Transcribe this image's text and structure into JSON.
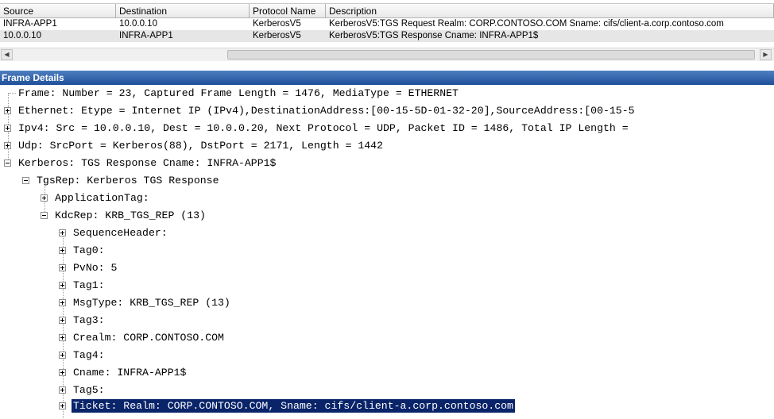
{
  "grid": {
    "columns": [
      "Source",
      "Destination",
      "Protocol Name",
      "Description"
    ],
    "rows": [
      {
        "source": "INFRA-APP1",
        "destination": "10.0.0.10",
        "protocol": "KerberosV5",
        "description": "KerberosV5:TGS Request Realm: CORP.CONTOSO.COM Sname: cifs/client-a.corp.contoso.com"
      },
      {
        "source": "10.0.0.10",
        "destination": "INFRA-APP1",
        "protocol": "KerberosV5",
        "description": "KerberosV5:TGS Response Cname: INFRA-APP1$"
      }
    ]
  },
  "details": {
    "title": "Frame Details",
    "nodes": [
      {
        "text": "Frame: Number = 23, Captured Frame Length = 1476, MediaType = ETHERNET",
        "expander": "none",
        "selected": false
      },
      {
        "text": "Ethernet: Etype = Internet IP (IPv4),DestinationAddress:[00-15-5D-01-32-20],SourceAddress:[00-15-5",
        "expander": "plus",
        "selected": false
      },
      {
        "text": "Ipv4: Src = 10.0.0.10, Dest = 10.0.0.20, Next Protocol = UDP, Packet ID = 1486, Total IP Length =",
        "expander": "plus",
        "selected": false
      },
      {
        "text": "Udp: SrcPort = Kerberos(88), DstPort = 2171, Length = 1442",
        "expander": "plus",
        "selected": false
      },
      {
        "text": "Kerberos: TGS Response Cname: INFRA-APP1$",
        "expander": "minus",
        "selected": false
      },
      {
        "text": "TgsRep: Kerberos TGS Response",
        "expander": "minus",
        "selected": false
      },
      {
        "text": "ApplicationTag:",
        "expander": "plus",
        "selected": false
      },
      {
        "text": "KdcRep: KRB_TGS_REP (13)",
        "expander": "minus",
        "selected": false
      },
      {
        "text": "SequenceHeader:",
        "expander": "plus",
        "selected": false
      },
      {
        "text": "Tag0:",
        "expander": "plus",
        "selected": false
      },
      {
        "text": "PvNo: 5",
        "expander": "plus",
        "selected": false
      },
      {
        "text": "Tag1:",
        "expander": "plus",
        "selected": false
      },
      {
        "text": "MsgType: KRB_TGS_REP (13)",
        "expander": "plus",
        "selected": false
      },
      {
        "text": "Tag3:",
        "expander": "plus",
        "selected": false
      },
      {
        "text": "Crealm: CORP.CONTOSO.COM",
        "expander": "plus",
        "selected": false
      },
      {
        "text": "Tag4:",
        "expander": "plus",
        "selected": false
      },
      {
        "text": "Cname: INFRA-APP1$",
        "expander": "plus",
        "selected": false
      },
      {
        "text": "Tag5:",
        "expander": "plus",
        "selected": false
      },
      {
        "text": "Ticket: Realm: CORP.CONTOSO.COM, Sname: cifs/client-a.corp.contoso.com",
        "expander": "plus",
        "selected": true
      }
    ]
  },
  "colors": {
    "title_bar": "#1f4f99",
    "selection": "#0a246a"
  }
}
